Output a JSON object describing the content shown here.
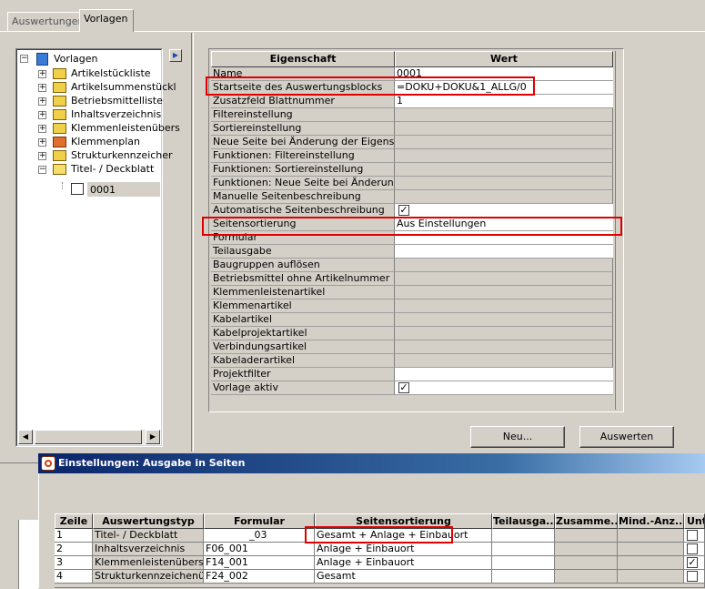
{
  "tabs": [
    {
      "label": "Auswertungen",
      "active": false
    },
    {
      "label": "Vorlagen",
      "active": true
    }
  ],
  "tree": {
    "root": "Vorlagen",
    "items": [
      {
        "label": "Artikelstückliste",
        "icon": "folder-icon"
      },
      {
        "label": "Artikelsummenstückl",
        "icon": "folder-icon"
      },
      {
        "label": "Betriebsmittelliste",
        "icon": "folder-icon"
      },
      {
        "label": "Inhaltsverzeichnis",
        "icon": "folder-icon"
      },
      {
        "label": "Klemmenleistenübers",
        "icon": "folder-icon"
      },
      {
        "label": "Klemmenplan",
        "icon": "folder-red-icon"
      },
      {
        "label": "Strukturkennzeicher",
        "icon": "folder-icon"
      },
      {
        "label": "Titel- / Deckblatt",
        "icon": "folder-open-icon"
      }
    ],
    "child": "0001"
  },
  "properties": {
    "header_name": "Eigenschaft",
    "header_value": "Wert",
    "rows": [
      {
        "name": "Name",
        "value": "0001"
      },
      {
        "name": "Startseite des Auswertungsblocks",
        "value": "=DOKU+DOKU&1_ALLG/0"
      },
      {
        "name": "Zusatzfeld Blattnummer",
        "value": "1"
      },
      {
        "name": "Filtereinstellung",
        "value": ""
      },
      {
        "name": "Sortiereinstellung",
        "value": ""
      },
      {
        "name": "Neue Seite bei Änderung der Eigenschaft",
        "value": ""
      },
      {
        "name": "Funktionen: Filtereinstellung",
        "value": ""
      },
      {
        "name": "Funktionen: Sortiereinstellung",
        "value": ""
      },
      {
        "name": "Funktionen: Neue Seite bei Änderung ...",
        "value": ""
      },
      {
        "name": "Manuelle Seitenbeschreibung",
        "value": ""
      },
      {
        "name": "Automatische Seitenbeschreibung",
        "value": "",
        "checked": true
      },
      {
        "name": "Seitensortierung",
        "value": "Aus Einstellungen"
      },
      {
        "name": "Formular",
        "value": ""
      },
      {
        "name": "Teilausgabe",
        "value": ""
      },
      {
        "name": "Baugruppen auflösen",
        "value": ""
      },
      {
        "name": "Betriebsmittel ohne Artikelnummer",
        "value": ""
      },
      {
        "name": "Klemmenleistenartikel",
        "value": ""
      },
      {
        "name": "Klemmenartikel",
        "value": ""
      },
      {
        "name": "Kabelartikel",
        "value": ""
      },
      {
        "name": "Kabelprojektartikel",
        "value": ""
      },
      {
        "name": "Verbindungsartikel",
        "value": ""
      },
      {
        "name": "Kabeladerartikel",
        "value": ""
      },
      {
        "name": "Projektfilter",
        "value": ""
      },
      {
        "name": "Vorlage aktiv",
        "value": "",
        "checked": true
      }
    ]
  },
  "buttons": {
    "new": "Neu...",
    "evaluate": "Auswerten"
  },
  "dialog": {
    "title": "Einstellungen: Ausgabe in Seiten",
    "columns": [
      "Zeile",
      "Auswertungstyp",
      "Formular",
      "Seitensortierung",
      "Teilausga...",
      "Zusamme...",
      "Mind.-Anz...",
      "Unt"
    ],
    "rows": [
      {
        "zeile": "1",
        "typ": "Titel- / Deckblatt",
        "formular": "_03",
        "sortierung": "Gesamt + Anlage + Einbauort",
        "checked": false
      },
      {
        "zeile": "2",
        "typ": "Inhaltsverzeichnis",
        "formular": "F06_001",
        "sortierung": "Anlage + Einbauort",
        "checked": false
      },
      {
        "zeile": "3",
        "typ": "Klemmenleistenübersicht",
        "formular": "F14_001",
        "sortierung": "Anlage + Einbauort",
        "checked": true
      },
      {
        "zeile": "4",
        "typ": "Strukturkennzeichenü...",
        "formular": "F24_002",
        "sortierung": "Gesamt",
        "checked": false
      }
    ]
  },
  "colors": {
    "background": "#d4d0c8",
    "highlight": "#e00000",
    "title_bar": "#0a246a"
  }
}
